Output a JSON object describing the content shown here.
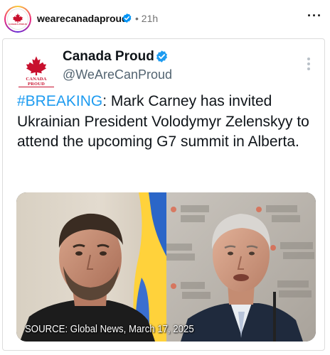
{
  "post": {
    "username": "wearecanadaproud",
    "separator": "•",
    "time": "21h",
    "more_icon": "ellipsis-icon",
    "avatar_text": "CANADA PROUD"
  },
  "tweet": {
    "account_name": "Canada Proud",
    "handle": "@WeAreCanProud",
    "logo_text": "CANADA PROUD",
    "hashtag": "#BREAKING",
    "body": ": Mark Carney has invited Ukrainian President Volodymyr Zelenskyy to attend the upcoming G7 summit in Alberta.",
    "image_caption": "SOURCE: Global News, March 17, 2025",
    "image_description_icons": [
      "zelenskyy-photo",
      "carney-photo"
    ]
  },
  "colors": {
    "hashtag": "#1d9bf0",
    "verified": "#0095f6",
    "brand_red": "#c8102e",
    "handle": "#536471"
  }
}
